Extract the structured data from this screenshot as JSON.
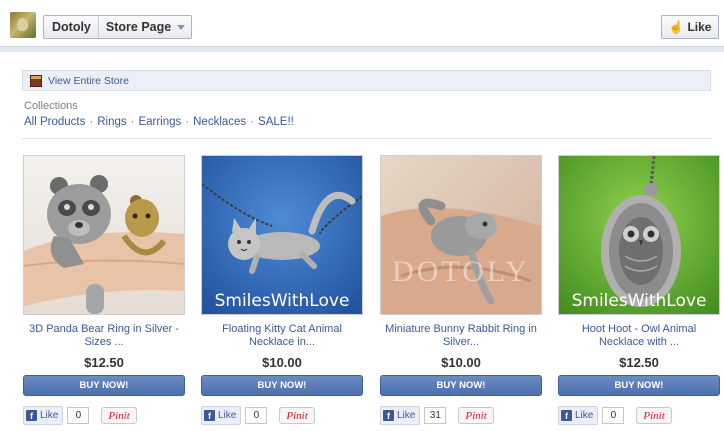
{
  "header": {
    "store_name": "Dotoly",
    "page_label": "Store Page",
    "like_label": "Like"
  },
  "store_bar": {
    "link": "View Entire Store"
  },
  "collections": {
    "heading": "Collections",
    "links": [
      "All Products",
      "Rings",
      "Earrings",
      "Necklaces",
      "SALE!!"
    ]
  },
  "products": [
    {
      "title": "3D Panda Bear Ring in Silver - Sizes ...",
      "price": "$12.50",
      "buy": "BUY NOW!",
      "like": "Like",
      "likes": "0",
      "pin": "Pinit",
      "watermark": ""
    },
    {
      "title": "Floating Kitty Cat Animal Necklace in...",
      "price": "$10.00",
      "buy": "BUY NOW!",
      "like": "Like",
      "likes": "0",
      "pin": "Pinit",
      "watermark": "SmilesWithLove"
    },
    {
      "title": "Miniature Bunny Rabbit Ring in Silver...",
      "price": "$10.00",
      "buy": "BUY NOW!",
      "like": "Like",
      "likes": "31",
      "pin": "Pinit",
      "watermark": ""
    },
    {
      "title": "Hoot Hoot - Owl Animal Necklace with ...",
      "price": "$12.50",
      "buy": "BUY NOW!",
      "like": "Like",
      "likes": "0",
      "pin": "Pinit",
      "watermark": "SmilesWithLove"
    }
  ],
  "colors": {
    "facebook_blue": "#3b5998",
    "button_blue": "#5b7bbb",
    "pinterest_red": "#cb2027"
  },
  "icons": [
    "store-logo-icon",
    "dropdown-caret-icon",
    "thumbs-up-icon",
    "store-icon",
    "facebook-icon"
  ]
}
